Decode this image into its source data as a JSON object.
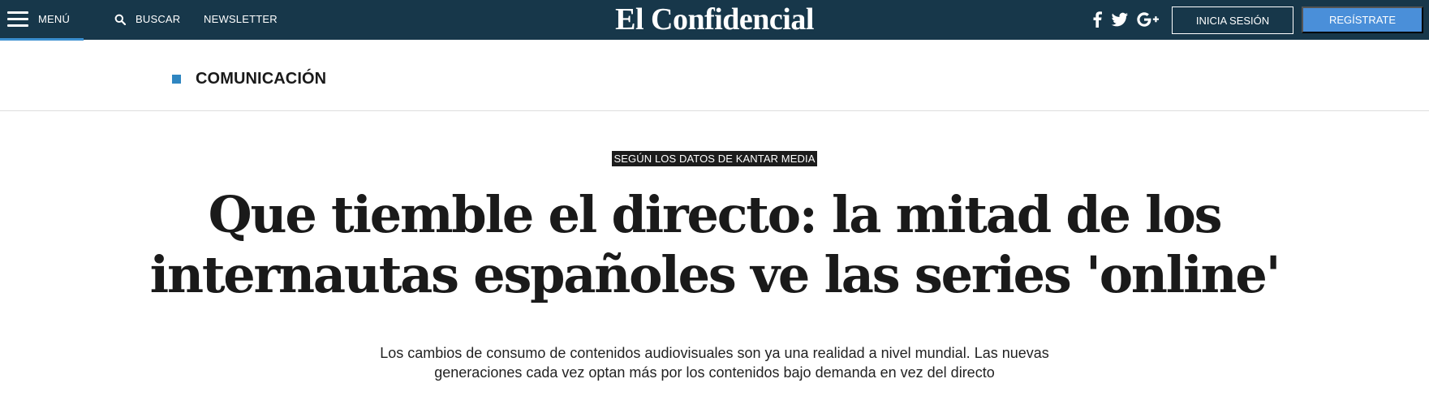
{
  "header": {
    "menu_label": "MENÚ",
    "search_label": "BUSCAR",
    "newsletter_label": "NEWSLETTER",
    "logo_text": "El Confidencial",
    "social_icons": [
      "facebook-icon",
      "twitter-icon",
      "google-plus-icon"
    ],
    "login_label": "INICIA SESIÓN",
    "register_label": "REGÍSTRATE",
    "colors": {
      "bar": "#17374a",
      "accent": "#3b8fd0",
      "register_button": "#4a8fd9"
    }
  },
  "section": {
    "label": "COMUNICACIÓN",
    "accent_color": "#2f86c1"
  },
  "article": {
    "kicker": "SEGÚN LOS DATOS DE KANTAR MEDIA",
    "headline": "Que tiemble el directo: la mitad de los internautas españoles ve las series 'online'",
    "subtitle": "Los cambios de consumo de contenidos audiovisuales son ya una realidad a nivel mundial. Las nuevas generaciones cada vez optan más por los contenidos bajo demanda en vez del directo"
  }
}
